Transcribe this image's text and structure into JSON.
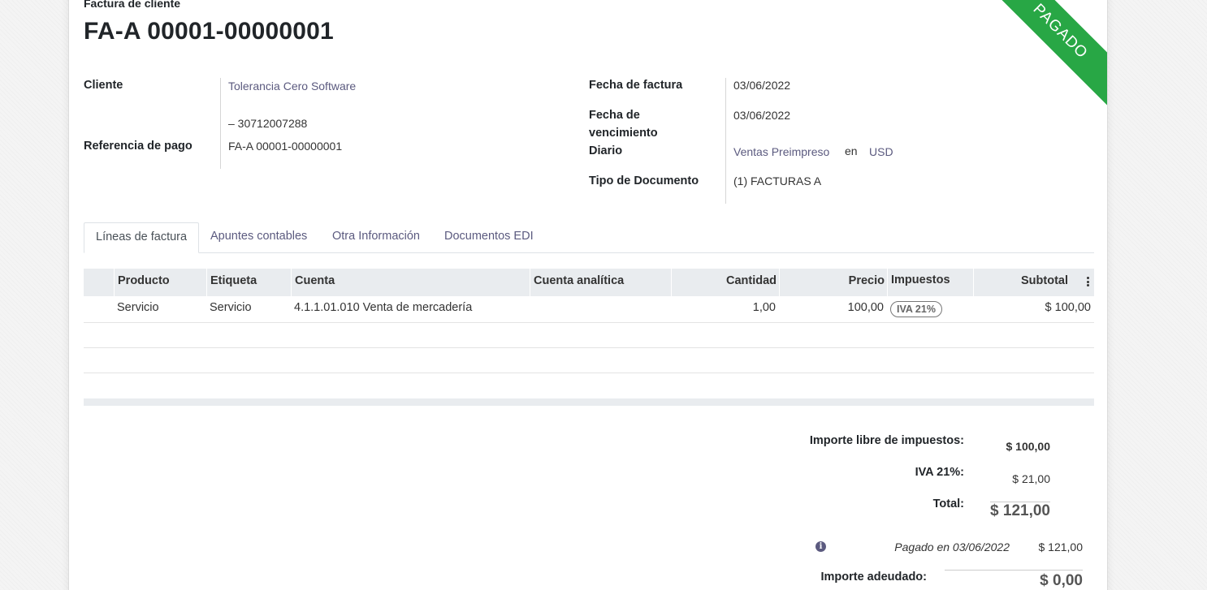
{
  "header": {
    "subtitle": "Factura de cliente",
    "title": "FA-A 00001-00000001",
    "status_ribbon": "PAGADO",
    "status_color": "#28a745"
  },
  "left_fields": {
    "customer_label": "Cliente",
    "customer_name": "Tolerancia Cero Software",
    "customer_vat": "– 30712007288",
    "payment_ref_label": "Referencia de pago",
    "payment_ref": "FA-A 00001-00000001"
  },
  "right_fields": {
    "invoice_date_label": "Fecha de factura",
    "invoice_date": "03/06/2022",
    "due_date_label_line1": "Fecha de",
    "due_date_label_line2": "vencimiento",
    "due_date": "03/06/2022",
    "journal_label": "Diario",
    "journal": "Ventas Preimpreso",
    "journal_in": "en",
    "currency": "USD",
    "doc_type_label": "Tipo de Documento",
    "doc_type": "(1) FACTURAS A"
  },
  "tabs": [
    "Líneas de factura",
    "Apuntes contables",
    "Otra Información",
    "Documentos EDI"
  ],
  "table": {
    "headers": [
      "Producto",
      "Etiqueta",
      "Cuenta",
      "Cuenta analítica",
      "Cantidad",
      "Precio",
      "Impuestos",
      "Subtotal"
    ],
    "rows": [
      {
        "product": "Servicio",
        "label": "Servicio",
        "account": "4.1.1.01.010 Venta de mercadería",
        "analytic": "",
        "quantity": "1,00",
        "price": "100,00",
        "tax": "IVA 21%",
        "subtotal": "$ 100,00"
      }
    ]
  },
  "totals": {
    "untaxed_label": "Importe libre de impuestos:",
    "untaxed": "$ 100,00",
    "tax_label": "IVA 21%:",
    "tax": "$ 21,00",
    "total_label": "Total:",
    "total": "$ 121,00",
    "payment_text": "Pagado en 03/06/2022",
    "payment_amount": "$ 121,00",
    "due_label": "Importe adeudado:",
    "due": "$ 0,00"
  }
}
